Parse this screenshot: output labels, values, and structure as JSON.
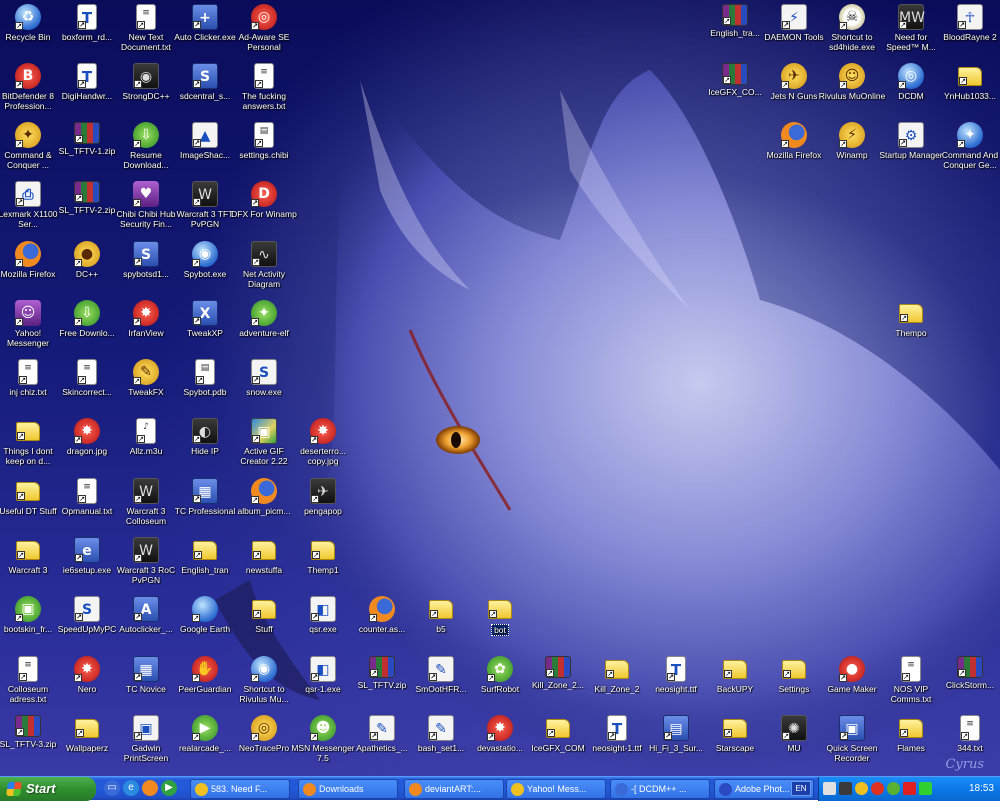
{
  "desktop": {
    "signature": "Cyrus",
    "icons_left": [
      {
        "label": "Recycle Bin",
        "icon": "recycle-bin-icon",
        "glyph": "♻",
        "kind": "globe"
      },
      {
        "label": "BitDefender 8 Profession...",
        "icon": "bitdefender-icon",
        "glyph": "B",
        "kind": "red"
      },
      {
        "label": "Command & Conquer ...",
        "icon": "command-conquer-icon",
        "glyph": "✦",
        "kind": "yellowc"
      },
      {
        "label": "Lexmark X1100 Ser...",
        "icon": "printer-icon",
        "glyph": "⎙",
        "kind": "white"
      },
      {
        "label": "Mozilla Firefox",
        "icon": "firefox-icon",
        "glyph": "",
        "kind": "ff"
      },
      {
        "label": "Yahoo! Messenger",
        "icon": "yahoo-messenger-icon",
        "glyph": "☺",
        "kind": "purple"
      },
      {
        "label": "inj chiz.txt",
        "icon": "text-file-icon",
        "glyph": "≡",
        "kind": "doc"
      },
      {
        "label": "Things I dont keep on d...",
        "icon": "folder-icon",
        "glyph": "",
        "kind": "folder"
      },
      {
        "label": "Useful DT Stuff",
        "icon": "folder-icon",
        "glyph": "",
        "kind": "folder"
      },
      {
        "label": "Warcraft 3",
        "icon": "folder-icon",
        "glyph": "",
        "kind": "folder"
      },
      {
        "label": "bootskin_fr...",
        "icon": "monitor-icon",
        "glyph": "▣",
        "kind": "green"
      },
      {
        "label": "Colloseum adress.txt",
        "icon": "text-file-icon",
        "glyph": "≡",
        "kind": "doc"
      },
      {
        "label": "SL_TFTV-3.zip",
        "icon": "zip-file-icon",
        "glyph": "",
        "kind": "zip"
      },
      {
        "label": "boxform_rd...",
        "icon": "font-file-icon",
        "glyph": "T",
        "kind": "font"
      },
      {
        "label": "DigiHandwr...",
        "icon": "font-file-icon",
        "glyph": "T",
        "kind": "font"
      },
      {
        "label": "SL_TFTV-1.zip",
        "icon": "zip-file-icon",
        "glyph": "",
        "kind": "zip"
      },
      {
        "label": "SL_TFTV-2.zip",
        "icon": "zip-file-icon",
        "glyph": "",
        "kind": "zip"
      },
      {
        "label": "DC++",
        "icon": "dcpp-icon",
        "glyph": "●",
        "kind": "yellowc"
      },
      {
        "label": "Free Downlo...",
        "icon": "download-icon",
        "glyph": "⇩",
        "kind": "green"
      },
      {
        "label": "Skincorrect...",
        "icon": "text-file-icon",
        "glyph": "≡",
        "kind": "doc"
      },
      {
        "label": "dragon.jpg",
        "icon": "image-file-icon",
        "glyph": "✸",
        "kind": "red"
      },
      {
        "label": "Opmanual.txt",
        "icon": "text-file-icon",
        "glyph": "≡",
        "kind": "doc"
      },
      {
        "label": "ie6setup.exe",
        "icon": "installer-icon",
        "glyph": "e",
        "kind": "exe"
      },
      {
        "label": "SpeedUpMyPC",
        "icon": "speedup-icon",
        "glyph": "S",
        "kind": "white"
      },
      {
        "label": "Nero",
        "icon": "nero-icon",
        "glyph": "✸",
        "kind": "red"
      },
      {
        "label": "Wallpaperz",
        "icon": "folder-icon",
        "glyph": "",
        "kind": "folder"
      },
      {
        "label": "New Text Document.txt",
        "icon": "text-file-icon",
        "glyph": "≡",
        "kind": "doc"
      },
      {
        "label": "StrongDC++",
        "icon": "strongdc-icon",
        "glyph": "◉",
        "kind": "dark"
      },
      {
        "label": "Resume Download...",
        "icon": "resume-download-icon",
        "glyph": "⇩",
        "kind": "green"
      },
      {
        "label": "Chibi Chibi Hub Security Fin...",
        "icon": "chibi-icon",
        "glyph": "♥",
        "kind": "purple"
      },
      {
        "label": "spybotsd1...",
        "icon": "installer-icon",
        "glyph": "S",
        "kind": "exe"
      },
      {
        "label": "IrfanView",
        "icon": "irfanview-icon",
        "glyph": "✸",
        "kind": "red"
      },
      {
        "label": "TweakFX",
        "icon": "tweakfx-icon",
        "glyph": "✎",
        "kind": "yellowc"
      },
      {
        "label": "Allz.m3u",
        "icon": "playlist-icon",
        "glyph": "♪",
        "kind": "doc"
      },
      {
        "label": "Warcraft 3 Colloseum",
        "icon": "warcraft-icon",
        "glyph": "W",
        "kind": "dark"
      },
      {
        "label": "Warcraft 3 RoC PvPGN",
        "icon": "warcraft-icon",
        "glyph": "W",
        "kind": "dark"
      },
      {
        "label": "Autoclicker_...",
        "icon": "autoclicker-icon",
        "glyph": "A",
        "kind": "exe"
      },
      {
        "label": "TC Novice",
        "icon": "tc-icon",
        "glyph": "▦",
        "kind": "exe"
      },
      {
        "label": "Gadwin PrintScreen",
        "icon": "printscreen-icon",
        "glyph": "▣",
        "kind": "white"
      },
      {
        "label": "Auto Clicker.exe",
        "icon": "auto-clicker-icon",
        "glyph": "+",
        "kind": "exe"
      },
      {
        "label": "sdcentral_s...",
        "icon": "installer-icon",
        "glyph": "S",
        "kind": "exe"
      },
      {
        "label": "ImageShac...",
        "icon": "imageshack-icon",
        "glyph": "▲",
        "kind": "white"
      },
      {
        "label": "Warcraft 3 TFT PvPGN",
        "icon": "warcraft-icon",
        "glyph": "W",
        "kind": "dark"
      },
      {
        "label": "Spybot.exe",
        "icon": "spybot-icon",
        "glyph": "◉",
        "kind": "globe"
      },
      {
        "label": "TweakXP",
        "icon": "tweakxp-icon",
        "glyph": "X",
        "kind": "exe"
      },
      {
        "label": "Spybot.pdb",
        "icon": "pdb-file-icon",
        "glyph": "▤",
        "kind": "doc"
      },
      {
        "label": "Hide IP",
        "icon": "hide-ip-icon",
        "glyph": "◐",
        "kind": "dark"
      },
      {
        "label": "TC Professional",
        "icon": "tc-icon",
        "glyph": "▦",
        "kind": "exe"
      },
      {
        "label": "English_tran",
        "icon": "folder-icon",
        "glyph": "",
        "kind": "folder"
      },
      {
        "label": "Google Earth",
        "icon": "google-earth-icon",
        "glyph": "",
        "kind": "globe"
      },
      {
        "label": "PeerGuardian",
        "icon": "peerguardian-icon",
        "glyph": "✋",
        "kind": "red"
      },
      {
        "label": "realarcade_...",
        "icon": "realarcade-icon",
        "glyph": "▶",
        "kind": "green"
      },
      {
        "label": "Ad-Aware SE Personal",
        "icon": "ad-aware-icon",
        "glyph": "◎",
        "kind": "red"
      },
      {
        "label": "The fucking answers.txt",
        "icon": "text-file-icon",
        "glyph": "≡",
        "kind": "doc"
      },
      {
        "label": "settings.chibi",
        "icon": "chibi-file-icon",
        "glyph": "▤",
        "kind": "doc"
      },
      {
        "label": "DFX For Winamp",
        "icon": "dfx-icon",
        "glyph": "D",
        "kind": "red"
      },
      {
        "label": "Net Activity Diagram",
        "icon": "net-activity-icon",
        "glyph": "∿",
        "kind": "dark"
      },
      {
        "label": "adventure-elf",
        "icon": "elf-icon",
        "glyph": "✦",
        "kind": "green"
      },
      {
        "label": "snow.exe",
        "icon": "snow-icon",
        "glyph": "S",
        "kind": "white"
      },
      {
        "label": "Active GIF Creator 2.22",
        "icon": "gif-creator-icon",
        "glyph": "▣",
        "kind": "img-photo"
      },
      {
        "label": "album_picm...",
        "icon": "firefox-document-icon",
        "glyph": "",
        "kind": "ff"
      },
      {
        "label": "newstuffa",
        "icon": "folder-icon",
        "glyph": "",
        "kind": "folder"
      },
      {
        "label": "Stuff",
        "icon": "folder-icon",
        "glyph": "",
        "kind": "folder"
      },
      {
        "label": "Shortcut to Rivulus Mu...",
        "icon": "rivulus-icon",
        "glyph": "◉",
        "kind": "globe"
      },
      {
        "label": "NeoTracePro",
        "icon": "neotrace-icon",
        "glyph": "◎",
        "kind": "yellowc"
      }
    ],
    "icons_extra": [
      {
        "label": "deserterro... copy.jpg",
        "icon": "image-file-icon",
        "glyph": "✸",
        "kind": "red"
      },
      {
        "label": "pengapop",
        "icon": "pengapop-icon",
        "glyph": "✈",
        "kind": "dark"
      },
      {
        "label": "Themp1",
        "icon": "folder-icon",
        "glyph": "",
        "kind": "folder"
      },
      {
        "label": "qsr.exe",
        "icon": "qsr-icon",
        "glyph": "◧",
        "kind": "white"
      },
      {
        "label": "qsr-1.exe",
        "icon": "qsr-icon",
        "glyph": "◧",
        "kind": "white"
      },
      {
        "label": "MSN Messenger 7.5",
        "icon": "msn-messenger-icon",
        "glyph": "☻",
        "kind": "green"
      },
      {
        "label": "counter.as...",
        "icon": "firefox-document-icon",
        "glyph": "",
        "kind": "ff"
      },
      {
        "label": "SL_TFTV.zip",
        "icon": "zip-file-icon",
        "glyph": "",
        "kind": "zip"
      },
      {
        "label": "Apathetics_...",
        "icon": "font-setup-icon",
        "glyph": "✎",
        "kind": "white"
      },
      {
        "label": "b5",
        "icon": "folder-icon",
        "glyph": "",
        "kind": "folder"
      },
      {
        "label": "SmOotHFR...",
        "icon": "font-setup-icon",
        "glyph": "✎",
        "kind": "white"
      },
      {
        "label": "bash_set1...",
        "icon": "font-setup-icon",
        "glyph": "✎",
        "kind": "white"
      },
      {
        "label": "bot",
        "icon": "folder-icon",
        "glyph": "",
        "kind": "folder",
        "selected": true
      },
      {
        "label": "SurfRobot",
        "icon": "surfrobot-icon",
        "glyph": "✿",
        "kind": "green"
      },
      {
        "label": "devastatio...",
        "icon": "image-file-icon",
        "glyph": "✸",
        "kind": "red"
      },
      {
        "label": "Kill_Zone_2...",
        "icon": "zip-file-icon",
        "glyph": "",
        "kind": "zip"
      },
      {
        "label": "IceGFX_COM",
        "icon": "folder-icon",
        "glyph": "",
        "kind": "folder"
      },
      {
        "label": "Kill_Zone_2",
        "icon": "folder-icon",
        "glyph": "",
        "kind": "folder"
      },
      {
        "label": "neosight-1.ttf",
        "icon": "font-file-icon",
        "glyph": "T",
        "kind": "font"
      },
      {
        "label": "neosight.ttf",
        "icon": "font-file-icon",
        "glyph": "T",
        "kind": "font"
      },
      {
        "label": "Hi_Fi_3_Sur...",
        "icon": "archive-window-icon",
        "glyph": "▤",
        "kind": "exe"
      },
      {
        "label": "BackUPY",
        "icon": "folder-icon",
        "glyph": "",
        "kind": "folder"
      },
      {
        "label": "Starscape",
        "icon": "folder-icon",
        "glyph": "",
        "kind": "folder"
      },
      {
        "label": "Settings",
        "icon": "folder-icon",
        "glyph": "",
        "kind": "folder"
      },
      {
        "label": "MU",
        "icon": "mu-icon",
        "glyph": "✺",
        "kind": "dark"
      },
      {
        "label": "Game Maker",
        "icon": "game-maker-icon",
        "glyph": "●",
        "kind": "red"
      },
      {
        "label": "Quick Screen Recorder",
        "icon": "screen-recorder-icon",
        "glyph": "▣",
        "kind": "exe"
      },
      {
        "label": "NOS VIP Comms.txt",
        "icon": "text-file-icon",
        "glyph": "≡",
        "kind": "doc"
      },
      {
        "label": "Flames",
        "icon": "folder-icon",
        "glyph": "",
        "kind": "folder"
      },
      {
        "label": "ClickStorm...",
        "icon": "zip-file-icon",
        "glyph": "",
        "kind": "zip"
      },
      {
        "label": "344.txt",
        "icon": "text-file-icon",
        "glyph": "≡",
        "kind": "doc"
      }
    ],
    "icons_right": [
      {
        "label": "English_tra...",
        "icon": "zip-file-icon",
        "glyph": "",
        "kind": "zip"
      },
      {
        "label": "DAEMON Tools",
        "icon": "daemon-tools-icon",
        "glyph": "⚡",
        "kind": "white"
      },
      {
        "label": "Shortcut to sd4hide.exe",
        "icon": "skull-icon",
        "glyph": "☠",
        "kind": "skull"
      },
      {
        "label": "Need for Speed™ M...",
        "icon": "nfs-icon",
        "glyph": "MW",
        "kind": "dark"
      },
      {
        "label": "BloodRayne 2",
        "icon": "bloodrayne-icon",
        "glyph": "☥",
        "kind": "white"
      },
      {
        "label": "IceGFX_CO...",
        "icon": "zip-file-icon",
        "glyph": "",
        "kind": "zip"
      },
      {
        "label": "Jets N Guns",
        "icon": "jets-n-guns-icon",
        "glyph": "✈",
        "kind": "yellowc"
      },
      {
        "label": "Rivulus MuOnline",
        "icon": "rivulus-icon",
        "glyph": "☺",
        "kind": "yellowc"
      },
      {
        "label": "DCDM",
        "icon": "dcdm-icon",
        "glyph": "◎",
        "kind": "globe"
      },
      {
        "label": "YnHub1033...",
        "icon": "folder-icon",
        "glyph": "",
        "kind": "folder"
      },
      {
        "label": "Mozilla Firefox",
        "icon": "firefox-icon",
        "glyph": "",
        "kind": "ff"
      },
      {
        "label": "Winamp",
        "icon": "winamp-icon",
        "glyph": "⚡",
        "kind": "yellowc"
      },
      {
        "label": "Startup Manager",
        "icon": "startup-manager-icon",
        "glyph": "⚙",
        "kind": "white"
      },
      {
        "label": "Command And Conquer Ge...",
        "icon": "command-conquer-icon",
        "glyph": "✦",
        "kind": "globe"
      },
      {
        "label": "Thempo",
        "icon": "folder-icon",
        "glyph": "",
        "kind": "folder"
      }
    ]
  },
  "taskbar": {
    "start_label": "Start",
    "quick_launch": [
      {
        "icon": "show-desktop-icon",
        "glyph": "▭"
      },
      {
        "icon": "internet-explorer-icon",
        "glyph": "e"
      },
      {
        "icon": "firefox-icon",
        "glyph": ""
      },
      {
        "icon": "media-player-icon",
        "glyph": "▶"
      }
    ],
    "tasks": [
      {
        "label": "583. Need F...",
        "icon": "winamp-task-icon"
      },
      {
        "label": "Downloads",
        "icon": "firefox-task-icon"
      },
      {
        "label": "deviantART:...",
        "icon": "firefox-task-icon"
      },
      {
        "label": "Yahoo! Mess...",
        "icon": "yahoo-task-icon"
      },
      {
        "label": "-[ DCDM++ ...",
        "icon": "dcdm-task-icon"
      },
      {
        "label": "Adobe Phot...",
        "icon": "photoshop-task-icon"
      }
    ],
    "language": "EN",
    "clock": "18:53"
  }
}
